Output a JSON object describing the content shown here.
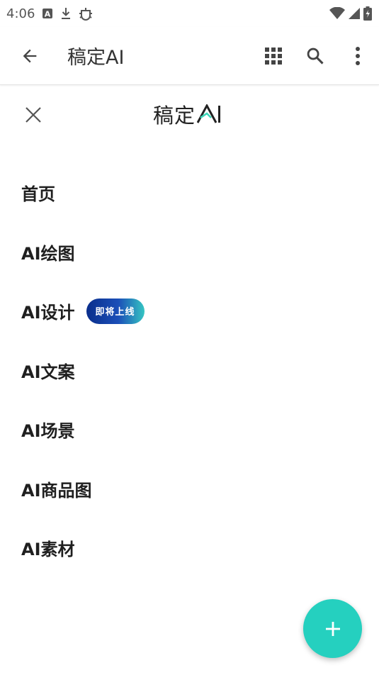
{
  "status_bar": {
    "time": "4:06",
    "icons": [
      "a-badge-icon",
      "download-icon",
      "bug-icon",
      "wifi-icon",
      "signal-icon",
      "battery-icon"
    ]
  },
  "app_bar": {
    "title": "稿定AI",
    "actions": [
      "back-icon",
      "apps-grid-icon",
      "search-icon",
      "more-vert-icon"
    ]
  },
  "menu": {
    "logo_text": "稿定",
    "logo_ai": "AI",
    "items": [
      {
        "label": "首页"
      },
      {
        "label": "AI绘图"
      },
      {
        "label": "AI设计",
        "badge": "即将上线"
      },
      {
        "label": "AI文案"
      },
      {
        "label": "AI场景"
      },
      {
        "label": "AI商品图"
      },
      {
        "label": "AI素材"
      }
    ]
  },
  "colors": {
    "fab": "#25d0bf",
    "badge_start": "#0a2e8c",
    "badge_end": "#35c5c2"
  }
}
